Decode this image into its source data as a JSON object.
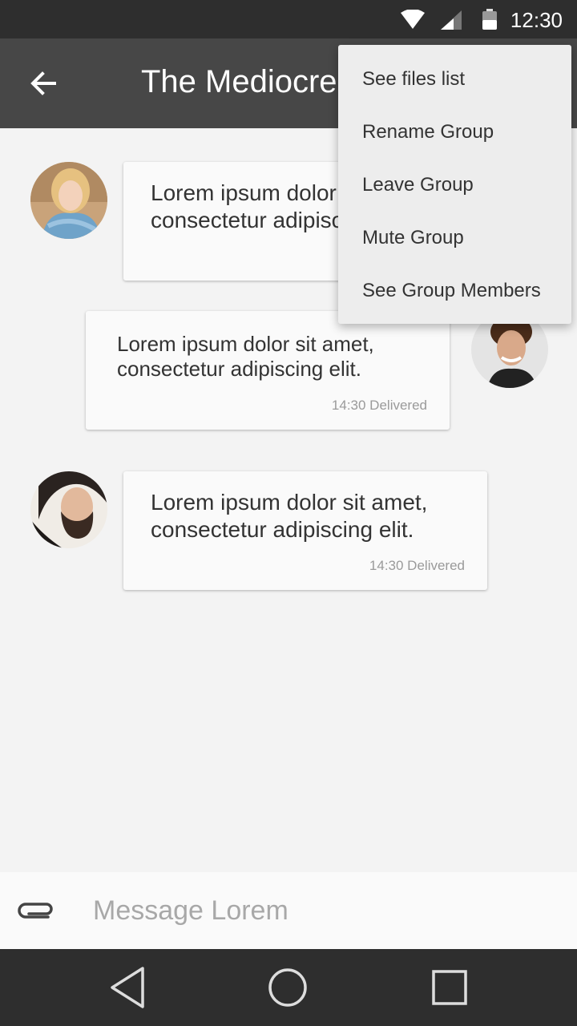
{
  "status_bar": {
    "time": "12:30",
    "icons": [
      "wifi-icon",
      "cell-signal-icon",
      "battery-icon"
    ]
  },
  "app_bar": {
    "title": "The Mediocre",
    "back_icon": "arrow-back-icon"
  },
  "messages": [
    {
      "sender": "incoming",
      "avatar": "avatar-blonde-woman",
      "text": "Lorem ipsum dolor sit amet, consectetur adipiscing elit.",
      "meta": ""
    },
    {
      "sender": "outgoing",
      "avatar": "avatar-curly-man",
      "text": "Lorem ipsum dolor sit amet, consectetur adipiscing elit.",
      "meta": "14:30 Delivered"
    },
    {
      "sender": "incoming",
      "avatar": "avatar-bearded-man",
      "text": "Lorem ipsum dolor sit amet, consectetur adipiscing elit.",
      "meta": "14:30 Delivered"
    }
  ],
  "composer": {
    "placeholder": "Message Lorem",
    "attach_icon": "paperclip-icon"
  },
  "menu": {
    "items": [
      "See files list",
      "Rename Group",
      "Leave Group",
      "Mute Group",
      "See Group Members"
    ]
  },
  "nav_bar": {
    "icons": [
      "back-triangle-icon",
      "home-circle-icon",
      "recents-square-icon"
    ]
  },
  "colors": {
    "status_bar": "#2e2e2e",
    "app_bar": "#474747",
    "background": "#f3f3f3",
    "bubble": "#fafafa",
    "menu": "#ededed"
  }
}
